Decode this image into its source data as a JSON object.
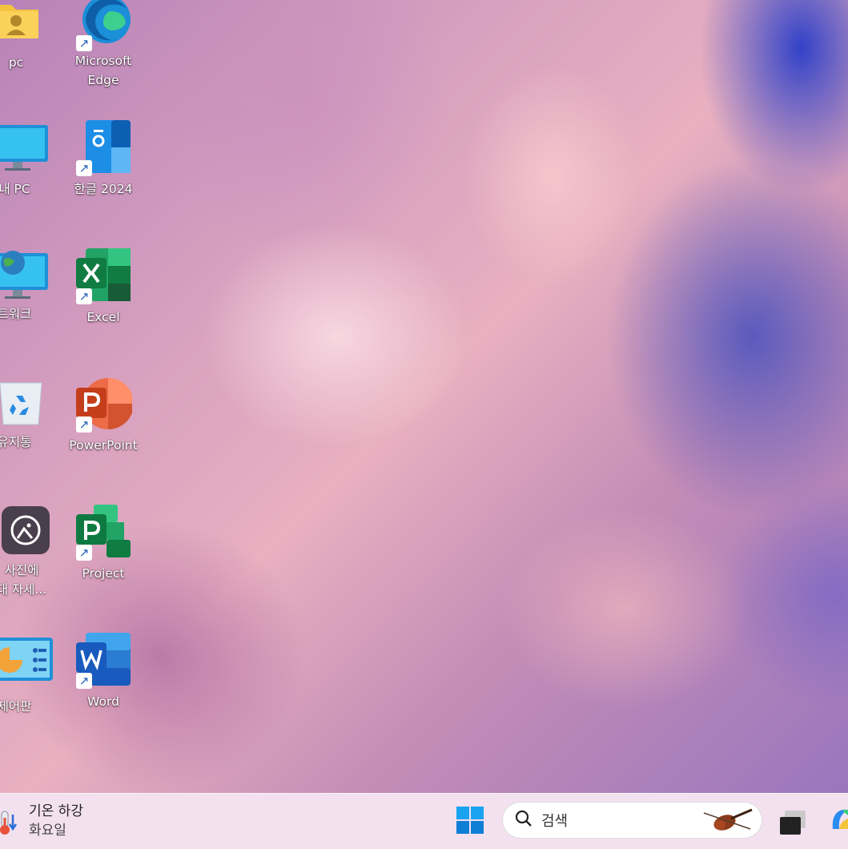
{
  "desktop": {
    "icons": [
      {
        "id": "pc",
        "label": "pc",
        "icon": "user-folder-icon"
      },
      {
        "id": "edge",
        "label": "Microsoft Edge",
        "label_line1": "Microsoft",
        "label_line2": "Edge",
        "icon": "edge-icon"
      },
      {
        "id": "thispc",
        "label": "내 PC",
        "icon": "monitor-icon"
      },
      {
        "id": "hangul",
        "label": "한글 2024",
        "icon": "hangul-icon"
      },
      {
        "id": "network",
        "label": "트워크",
        "icon": "network-icon"
      },
      {
        "id": "excel",
        "label": "Excel",
        "icon": "excel-icon"
      },
      {
        "id": "recycle",
        "label": "유지통",
        "icon": "recycle-bin-icon"
      },
      {
        "id": "powerpoint",
        "label": "PowerPoint",
        "icon": "powerpoint-icon"
      },
      {
        "id": "photos",
        "label_line1": "사진에",
        "label_line2": "대 자세...",
        "icon": "photo-learn-icon"
      },
      {
        "id": "project",
        "label": "Project",
        "icon": "project-icon"
      },
      {
        "id": "control",
        "label": "제어판",
        "icon": "control-panel-icon"
      },
      {
        "id": "word",
        "label": "Word",
        "icon": "word-icon"
      }
    ]
  },
  "taskbar": {
    "weather": {
      "line1": "기온 하강",
      "line2": "화요일",
      "icon": "thermometer-down-icon"
    },
    "start_icon": "windows-start-icon",
    "search": {
      "placeholder": "검색",
      "icon": "search-icon",
      "highlight_icon": "violin-icon"
    },
    "task_view_icon": "task-view-icon",
    "copilot_icon": "copilot-icon"
  }
}
